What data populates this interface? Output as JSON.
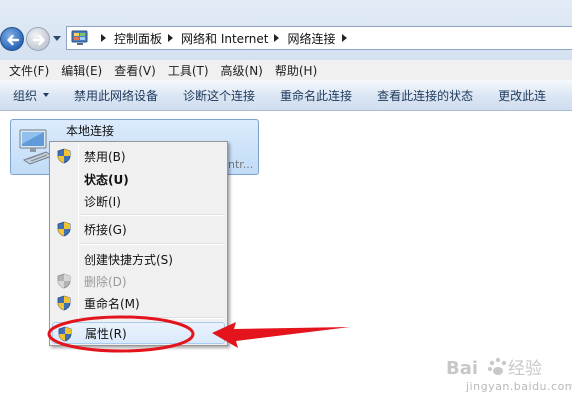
{
  "address_bar": {
    "breadcrumbs": [
      "控制面板",
      "网络和 Internet",
      "网络连接"
    ],
    "icons": [
      "back-arrow-icon",
      "forward-arrow-icon",
      "control-panel-icon"
    ]
  },
  "menu_bar": {
    "items": [
      "文件(F)",
      "编辑(E)",
      "查看(V)",
      "工具(T)",
      "高级(N)",
      "帮助(H)"
    ]
  },
  "command_bar": {
    "organize": "组织",
    "items": [
      "禁用此网络设备",
      "诊断这个连接",
      "重命名此连接",
      "查看此连接的状态",
      "更改此连"
    ]
  },
  "connection": {
    "name": "本地连接",
    "sub_fragment": "ntr...",
    "icon": "network-adapter-icon"
  },
  "context_menu": {
    "items": [
      {
        "label": "禁用(B)",
        "shield": true,
        "bold": false,
        "disabled": false
      },
      {
        "label": "状态(U)",
        "shield": false,
        "bold": true,
        "disabled": false
      },
      {
        "label": "诊断(I)",
        "shield": false,
        "bold": false,
        "disabled": false
      },
      {
        "label": "桥接(G)",
        "shield": true,
        "bold": false,
        "disabled": false
      },
      {
        "label": "创建快捷方式(S)",
        "shield": false,
        "bold": false,
        "disabled": false
      },
      {
        "label": "删除(D)",
        "shield": true,
        "bold": false,
        "disabled": true
      },
      {
        "label": "重命名(M)",
        "shield": true,
        "bold": false,
        "disabled": false
      },
      {
        "label": "属性(R)",
        "shield": true,
        "bold": false,
        "disabled": false
      }
    ]
  },
  "annotation": {
    "color": "#e3141c",
    "highlighted_item": "属性(R)"
  },
  "watermark": {
    "text": "jingyan.baidu.com"
  }
}
